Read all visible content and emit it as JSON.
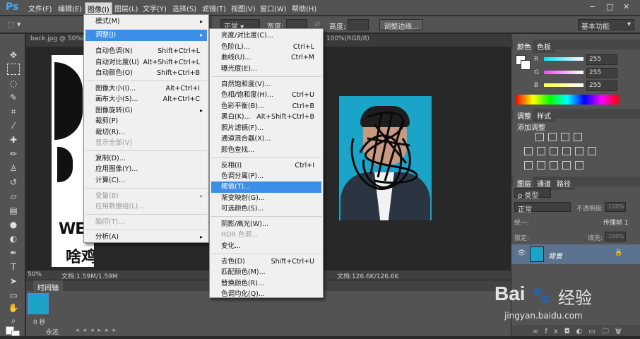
{
  "menubar": {
    "logo": "Ps",
    "items": [
      "文件(F)",
      "编辑(E)",
      "图像(I)",
      "图层(L)",
      "文字(Y)",
      "选择(S)",
      "滤镜(T)",
      "视图(V)",
      "窗口(W)",
      "帮助(H)"
    ]
  },
  "options": {
    "mode_value": "正常",
    "width_label": "宽度:",
    "height_label": "高度:",
    "refine_edge": "调整边缘...",
    "workspace": "基本功能"
  },
  "doc": {
    "tab1": "back.jpg @ 50%(RG",
    "tab2": "100%(RGB/8)",
    "zoom": "50%",
    "docsize1": "文档:1.59M/1.59M",
    "docsize2": "文档:126.6K/126.6K",
    "canvas_text_1": "WE",
    "canvas_text_2": "啥鸡巴人品"
  },
  "timeline": {
    "title": "时间轴",
    "frame_time": "0 秒",
    "loop": "永远"
  },
  "image_menu": {
    "items": [
      {
        "label": "模式(M)",
        "arrow": true
      },
      {
        "label": "调整(J)",
        "arrow": true,
        "highlight": true
      },
      {
        "label": "自动色调(N)",
        "shortcut": "Shift+Ctrl+L"
      },
      {
        "label": "自动对比度(U)",
        "shortcut": "Alt+Shift+Ctrl+L"
      },
      {
        "label": "自动颜色(O)",
        "shortcut": "Shift+Ctrl+B"
      },
      {
        "label": "图像大小(I)...",
        "shortcut": "Alt+Ctrl+I"
      },
      {
        "label": "画布大小(S)...",
        "shortcut": "Alt+Ctrl+C"
      },
      {
        "label": "图像旋转(G)",
        "arrow": true
      },
      {
        "label": "裁剪(P)"
      },
      {
        "label": "裁切(R)..."
      },
      {
        "label": "显示全部(V)",
        "disabled": true
      },
      {
        "label": "复制(D)..."
      },
      {
        "label": "应用图像(Y)..."
      },
      {
        "label": "计算(C)..."
      },
      {
        "label": "变量(B)",
        "arrow": true,
        "disabled": true
      },
      {
        "label": "应用数据组(L)...",
        "disabled": true
      },
      {
        "label": "陷印(T)...",
        "disabled": true
      },
      {
        "label": "分析(A)",
        "arrow": true
      }
    ]
  },
  "adjust_menu": {
    "items": [
      {
        "label": "亮度/对比度(C)..."
      },
      {
        "label": "色阶(L)...",
        "shortcut": "Ctrl+L"
      },
      {
        "label": "曲线(U)...",
        "shortcut": "Ctrl+M"
      },
      {
        "label": "曝光度(E)..."
      },
      {
        "label": "自然饱和度(V)..."
      },
      {
        "label": "色相/饱和度(H)...",
        "shortcut": "Ctrl+U"
      },
      {
        "label": "色彩平衡(B)...",
        "shortcut": "Ctrl+B"
      },
      {
        "label": "黑白(K)...",
        "shortcut": "Alt+Shift+Ctrl+B"
      },
      {
        "label": "照片滤镜(F)..."
      },
      {
        "label": "通道混合器(X)..."
      },
      {
        "label": "颜色查找..."
      },
      {
        "label": "反相(I)",
        "shortcut": "Ctrl+I"
      },
      {
        "label": "色调分离(P)..."
      },
      {
        "label": "阈值(T)...",
        "highlight": true
      },
      {
        "label": "渐变映射(G)..."
      },
      {
        "label": "可选颜色(S)..."
      },
      {
        "label": "阴影/高光(W)..."
      },
      {
        "label": "HDR 色调...",
        "disabled": true
      },
      {
        "label": "变化..."
      },
      {
        "label": "去色(D)",
        "shortcut": "Shift+Ctrl+U"
      },
      {
        "label": "匹配颜色(M)..."
      },
      {
        "label": "替换颜色(R)..."
      },
      {
        "label": "色调均化(Q)..."
      }
    ]
  },
  "color_panel": {
    "tabs": [
      "颜色",
      "色板"
    ],
    "channels": [
      {
        "label": "R",
        "value": "255",
        "color": "#00e5ff"
      },
      {
        "label": "G",
        "value": "255",
        "color": "#ff40ff"
      },
      {
        "label": "B",
        "value": "255",
        "color": "#ffff40"
      }
    ]
  },
  "adjust_panel": {
    "tabs": [
      "调整",
      "样式"
    ],
    "add_label": "添加调整"
  },
  "layers_panel": {
    "tabs": [
      "图层",
      "通道",
      "路径"
    ],
    "filter_label": "ρ 类型",
    "blend_mode": "正常",
    "opacity_label": "不透明度:",
    "opacity_value": "100%",
    "unify_label": "统一:",
    "propagate_label": "传播帧 1",
    "lock_label": "锁定:",
    "fill_label": "填充:",
    "fill_value": "100%",
    "layer_name": "背景"
  },
  "watermark": {
    "brand": "Bai",
    "brand2": "经验",
    "url": "jingyan.baidu.com"
  }
}
